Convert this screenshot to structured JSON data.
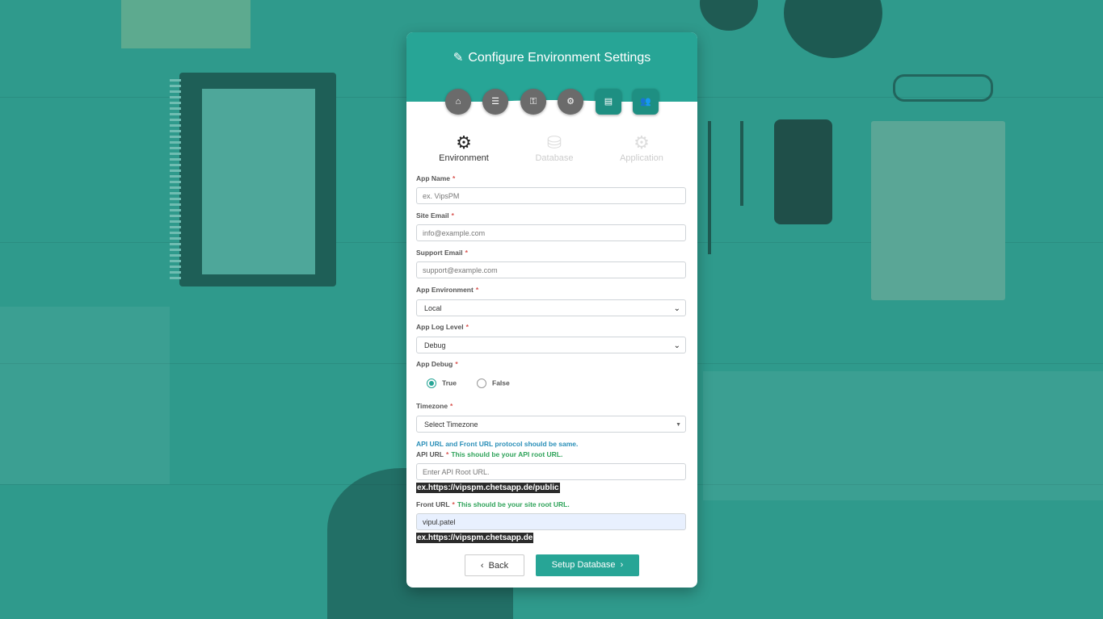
{
  "header": {
    "title": "Configure Environment Settings",
    "title_icon": "magic-wand-icon",
    "steps": [
      {
        "icon": "home-icon",
        "glyph": "⌂",
        "active": false
      },
      {
        "icon": "list-icon",
        "glyph": "☰",
        "active": false
      },
      {
        "icon": "key-icon",
        "glyph": "⚿",
        "active": false
      },
      {
        "icon": "gear-icon",
        "glyph": "⚙",
        "active": false
      },
      {
        "icon": "server-icon",
        "glyph": "▤",
        "active": true
      },
      {
        "icon": "users-icon",
        "glyph": "👥",
        "active": true
      }
    ]
  },
  "tabs": [
    {
      "label": "Environment",
      "icon": "gear-icon",
      "glyph": "⚙",
      "active": true
    },
    {
      "label": "Database",
      "icon": "database-icon",
      "glyph": "⛁",
      "active": false
    },
    {
      "label": "Application",
      "icon": "gears-icon",
      "glyph": "⚙",
      "active": false
    }
  ],
  "form": {
    "app_name": {
      "label": "App Name",
      "placeholder": "ex. VipsPM"
    },
    "site_email": {
      "label": "Site Email",
      "placeholder": "info@example.com"
    },
    "support_email": {
      "label": "Support Email",
      "placeholder": "support@example.com"
    },
    "app_environment": {
      "label": "App Environment",
      "value": "Local"
    },
    "app_log_level": {
      "label": "App Log Level",
      "value": "Debug"
    },
    "app_debug": {
      "label": "App Debug",
      "options": [
        "True",
        "False"
      ],
      "selected": "True"
    },
    "timezone": {
      "label": "Timezone",
      "value": "Select Timezone"
    },
    "protocol_note": "API URL and Front URL protocol should be same.",
    "api_url": {
      "label": "API URL",
      "note": "This should be your API root URL.",
      "placeholder": "Enter API Root URL.",
      "example": "ex.https://vipspm.chetsapp.de/public"
    },
    "front_url": {
      "label": "Front URL",
      "note": "This should be your site root URL.",
      "value": "vipul.patel",
      "example": "ex.https://vipspm.chetsapp.de"
    },
    "required_mark": "*"
  },
  "buttons": {
    "back": "Back",
    "back_icon": "‹",
    "next": "Setup Database",
    "next_icon": "›"
  },
  "colors": {
    "accent": "#27a596",
    "required": "#d9534f",
    "note": "#2fa35a",
    "info": "#2a8fb8"
  }
}
